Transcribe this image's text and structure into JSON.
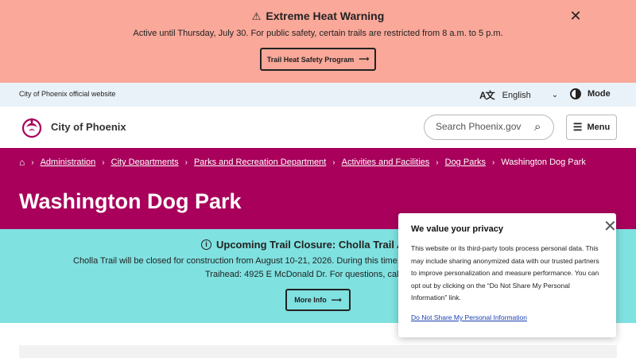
{
  "alert": {
    "title": "Extreme Heat Warning",
    "message": "Active until Thursday, July 30. For public safety, certain trails are restricted from 8 a.m. to 5 p.m.",
    "button_label": "Trail Heat Safety Program",
    "icons": {
      "warning": "warning-icon",
      "close": "close-icon",
      "arrow": "arrow-right-icon"
    }
  },
  "utility": {
    "official_text": "City of Phoenix official website",
    "language": "English",
    "mode_label": "Mode"
  },
  "header": {
    "logo_text": "City of Phoenix",
    "search_placeholder": "Search Phoenix.gov",
    "menu_label": "Menu"
  },
  "breadcrumb": {
    "items": [
      "Administration",
      "City Departments",
      "Parks and Recreation Department",
      "Activities and Facilities",
      "Dog Parks"
    ],
    "current": "Washington Dog Park"
  },
  "page": {
    "title": "Washington Dog Park"
  },
  "closure": {
    "title": "Upcoming Trail Closure: Cholla Trail Aug. 1",
    "line1": "Cholla Trail will be closed for construction from August 10-21, 2026. During this time, please",
    "line2": "Traihead: 4925 E McDonald Dr. For questions, call 602-",
    "button_label": "More Info"
  },
  "privacy": {
    "title": "We value your privacy",
    "body": "This website or its third-party tools process personal data. This may include sharing anonymized data with our trusted partners to improve personalization and measure performance. You can opt out by clicking on the “Do Not Share My Personal Information” link.",
    "link": "Do Not Share My Personal Information"
  },
  "colors": {
    "alert_bg": "#f9a899",
    "utility_bg": "#eaf2f9",
    "brand": "#a8005b",
    "closure_bg": "#7fe1e0",
    "link": "#1a3fb5"
  }
}
